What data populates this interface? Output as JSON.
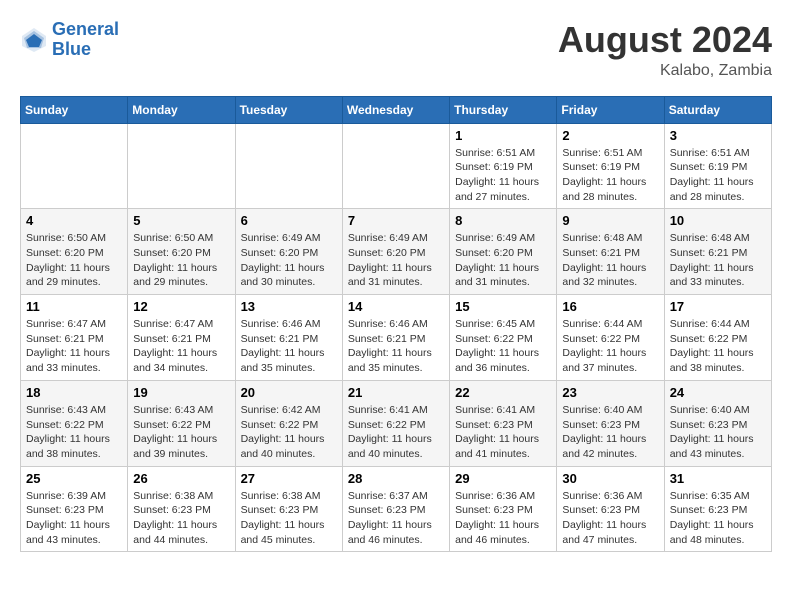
{
  "header": {
    "logo_line1": "General",
    "logo_line2": "Blue",
    "month_year": "August 2024",
    "location": "Kalabo, Zambia"
  },
  "weekdays": [
    "Sunday",
    "Monday",
    "Tuesday",
    "Wednesday",
    "Thursday",
    "Friday",
    "Saturday"
  ],
  "weeks": [
    [
      {
        "day": "",
        "info": ""
      },
      {
        "day": "",
        "info": ""
      },
      {
        "day": "",
        "info": ""
      },
      {
        "day": "",
        "info": ""
      },
      {
        "day": "1",
        "info": "Sunrise: 6:51 AM\nSunset: 6:19 PM\nDaylight: 11 hours and 27 minutes."
      },
      {
        "day": "2",
        "info": "Sunrise: 6:51 AM\nSunset: 6:19 PM\nDaylight: 11 hours and 28 minutes."
      },
      {
        "day": "3",
        "info": "Sunrise: 6:51 AM\nSunset: 6:19 PM\nDaylight: 11 hours and 28 minutes."
      }
    ],
    [
      {
        "day": "4",
        "info": "Sunrise: 6:50 AM\nSunset: 6:20 PM\nDaylight: 11 hours and 29 minutes."
      },
      {
        "day": "5",
        "info": "Sunrise: 6:50 AM\nSunset: 6:20 PM\nDaylight: 11 hours and 29 minutes."
      },
      {
        "day": "6",
        "info": "Sunrise: 6:49 AM\nSunset: 6:20 PM\nDaylight: 11 hours and 30 minutes."
      },
      {
        "day": "7",
        "info": "Sunrise: 6:49 AM\nSunset: 6:20 PM\nDaylight: 11 hours and 31 minutes."
      },
      {
        "day": "8",
        "info": "Sunrise: 6:49 AM\nSunset: 6:20 PM\nDaylight: 11 hours and 31 minutes."
      },
      {
        "day": "9",
        "info": "Sunrise: 6:48 AM\nSunset: 6:21 PM\nDaylight: 11 hours and 32 minutes."
      },
      {
        "day": "10",
        "info": "Sunrise: 6:48 AM\nSunset: 6:21 PM\nDaylight: 11 hours and 33 minutes."
      }
    ],
    [
      {
        "day": "11",
        "info": "Sunrise: 6:47 AM\nSunset: 6:21 PM\nDaylight: 11 hours and 33 minutes."
      },
      {
        "day": "12",
        "info": "Sunrise: 6:47 AM\nSunset: 6:21 PM\nDaylight: 11 hours and 34 minutes."
      },
      {
        "day": "13",
        "info": "Sunrise: 6:46 AM\nSunset: 6:21 PM\nDaylight: 11 hours and 35 minutes."
      },
      {
        "day": "14",
        "info": "Sunrise: 6:46 AM\nSunset: 6:21 PM\nDaylight: 11 hours and 35 minutes."
      },
      {
        "day": "15",
        "info": "Sunrise: 6:45 AM\nSunset: 6:22 PM\nDaylight: 11 hours and 36 minutes."
      },
      {
        "day": "16",
        "info": "Sunrise: 6:44 AM\nSunset: 6:22 PM\nDaylight: 11 hours and 37 minutes."
      },
      {
        "day": "17",
        "info": "Sunrise: 6:44 AM\nSunset: 6:22 PM\nDaylight: 11 hours and 38 minutes."
      }
    ],
    [
      {
        "day": "18",
        "info": "Sunrise: 6:43 AM\nSunset: 6:22 PM\nDaylight: 11 hours and 38 minutes."
      },
      {
        "day": "19",
        "info": "Sunrise: 6:43 AM\nSunset: 6:22 PM\nDaylight: 11 hours and 39 minutes."
      },
      {
        "day": "20",
        "info": "Sunrise: 6:42 AM\nSunset: 6:22 PM\nDaylight: 11 hours and 40 minutes."
      },
      {
        "day": "21",
        "info": "Sunrise: 6:41 AM\nSunset: 6:22 PM\nDaylight: 11 hours and 40 minutes."
      },
      {
        "day": "22",
        "info": "Sunrise: 6:41 AM\nSunset: 6:23 PM\nDaylight: 11 hours and 41 minutes."
      },
      {
        "day": "23",
        "info": "Sunrise: 6:40 AM\nSunset: 6:23 PM\nDaylight: 11 hours and 42 minutes."
      },
      {
        "day": "24",
        "info": "Sunrise: 6:40 AM\nSunset: 6:23 PM\nDaylight: 11 hours and 43 minutes."
      }
    ],
    [
      {
        "day": "25",
        "info": "Sunrise: 6:39 AM\nSunset: 6:23 PM\nDaylight: 11 hours and 43 minutes."
      },
      {
        "day": "26",
        "info": "Sunrise: 6:38 AM\nSunset: 6:23 PM\nDaylight: 11 hours and 44 minutes."
      },
      {
        "day": "27",
        "info": "Sunrise: 6:38 AM\nSunset: 6:23 PM\nDaylight: 11 hours and 45 minutes."
      },
      {
        "day": "28",
        "info": "Sunrise: 6:37 AM\nSunset: 6:23 PM\nDaylight: 11 hours and 46 minutes."
      },
      {
        "day": "29",
        "info": "Sunrise: 6:36 AM\nSunset: 6:23 PM\nDaylight: 11 hours and 46 minutes."
      },
      {
        "day": "30",
        "info": "Sunrise: 6:36 AM\nSunset: 6:23 PM\nDaylight: 11 hours and 47 minutes."
      },
      {
        "day": "31",
        "info": "Sunrise: 6:35 AM\nSunset: 6:23 PM\nDaylight: 11 hours and 48 minutes."
      }
    ]
  ]
}
